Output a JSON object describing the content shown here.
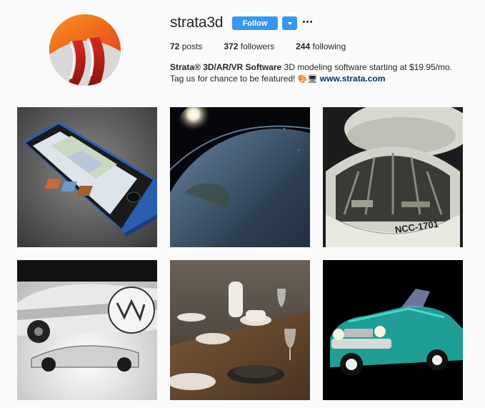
{
  "profile": {
    "username": "strata3d",
    "follow_label": "Follow",
    "posts_count": "72",
    "posts_label": " posts",
    "followers_count": "372",
    "followers_label": " followers",
    "following_count": "244",
    "following_label": " following",
    "bio_name": "Strata® 3D/AR/VR Software",
    "bio_text": " 3D modeling software starting at $19.95/mo. Tag us for chance to be featured! ",
    "bio_emoji": "🎨🖥",
    "bio_link": "www.strata.com"
  },
  "colors": {
    "follow_blue": "#3897f0",
    "link_blue": "#003569",
    "background": "#fafafa"
  },
  "posts": [
    {
      "subject": "3D smartphone render",
      "icon": "phone-render"
    },
    {
      "subject": "Earth from space with sunrise",
      "icon": "earth-render"
    },
    {
      "subject": "Starship hangar NCC-1701",
      "icon": "starship-render",
      "label": "NCC-1701"
    },
    {
      "subject": "Futuristic vehicles render",
      "icon": "vehicle-render"
    },
    {
      "subject": "Dinner table setting render",
      "icon": "tableware-render"
    },
    {
      "subject": "Vintage teal convertible car",
      "icon": "car-render"
    }
  ]
}
